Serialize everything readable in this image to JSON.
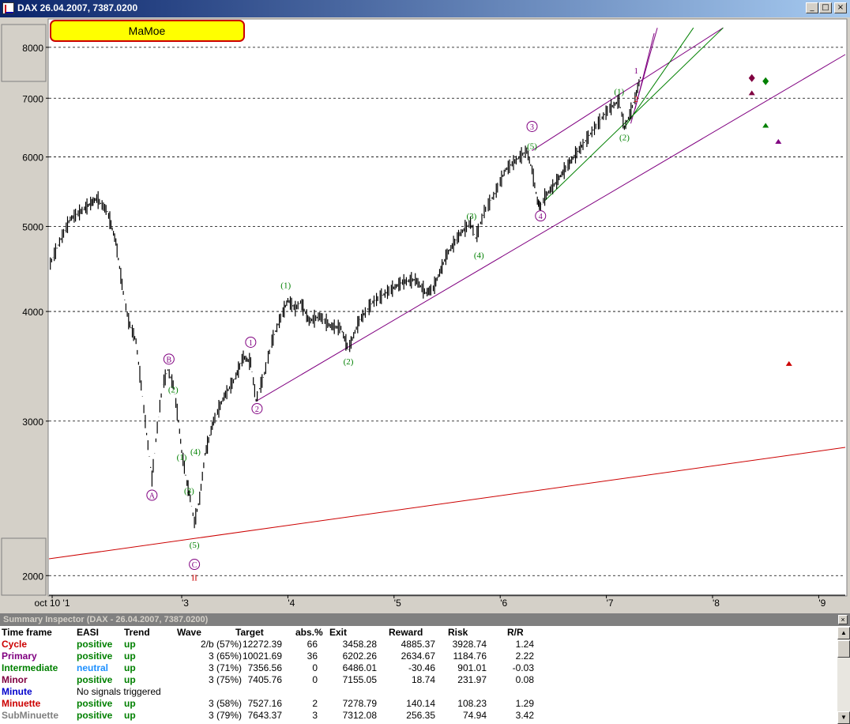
{
  "window": {
    "title": "DAX  26.04.2007, 7387.0200",
    "min_glyph": "_",
    "max_glyph": "□",
    "close_glyph": "×"
  },
  "chart_data": {
    "type": "line",
    "series_type": "ohlc-bars",
    "log_scale": true,
    "grid": "horizontal-dashed",
    "badge": "MaMoe",
    "y_ticks": [
      2000,
      3000,
      4000,
      5000,
      6000,
      7000,
      8000
    ],
    "x_ticks": [
      "oct 10 '1",
      "'3",
      "'4",
      "'5",
      "'6",
      "'7",
      "'8",
      "'9"
    ],
    "x_tick_years": [
      2001.78,
      2003.0,
      2004.0,
      2005.0,
      2006.0,
      2007.0,
      2008.0,
      2009.0
    ],
    "xlim": [
      2001.75,
      2009.25
    ],
    "ylim": [
      1900,
      8600
    ],
    "price_path": [
      [
        2001.75,
        4500
      ],
      [
        2001.85,
        4800
      ],
      [
        2001.95,
        5100
      ],
      [
        2002.05,
        5200
      ],
      [
        2002.2,
        5380
      ],
      [
        2002.3,
        5200
      ],
      [
        2002.38,
        4800
      ],
      [
        2002.45,
        4200
      ],
      [
        2002.5,
        3900
      ],
      [
        2002.57,
        3700
      ],
      [
        2002.63,
        3200
      ],
      [
        2002.67,
        2900
      ],
      [
        2002.72,
        2580
      ],
      [
        2002.77,
        2950
      ],
      [
        2002.82,
        3300
      ],
      [
        2002.87,
        3430
      ],
      [
        2002.92,
        3300
      ],
      [
        2002.97,
        3000
      ],
      [
        2003.0,
        2770
      ],
      [
        2003.05,
        2550
      ],
      [
        2003.08,
        2450
      ],
      [
        2003.12,
        2300
      ],
      [
        2003.17,
        2450
      ],
      [
        2003.22,
        2750
      ],
      [
        2003.3,
        3000
      ],
      [
        2003.4,
        3200
      ],
      [
        2003.5,
        3350
      ],
      [
        2003.58,
        3550
      ],
      [
        2003.65,
        3500
      ],
      [
        2003.7,
        3170
      ],
      [
        2003.78,
        3400
      ],
      [
        2003.85,
        3700
      ],
      [
        2003.92,
        3900
      ],
      [
        2004.0,
        4120
      ],
      [
        2004.07,
        4030
      ],
      [
        2004.12,
        4100
      ],
      [
        2004.2,
        3900
      ],
      [
        2004.3,
        3950
      ],
      [
        2004.4,
        3850
      ],
      [
        2004.5,
        3830
      ],
      [
        2004.57,
        3620
      ],
      [
        2004.67,
        3900
      ],
      [
        2004.8,
        4100
      ],
      [
        2004.95,
        4220
      ],
      [
        2005.08,
        4320
      ],
      [
        2005.2,
        4350
      ],
      [
        2005.3,
        4200
      ],
      [
        2005.37,
        4250
      ],
      [
        2005.5,
        4650
      ],
      [
        2005.62,
        4900
      ],
      [
        2005.72,
        5050
      ],
      [
        2005.77,
        4850
      ],
      [
        2005.85,
        5200
      ],
      [
        2005.95,
        5450
      ],
      [
        2006.05,
        5800
      ],
      [
        2006.15,
        5950
      ],
      [
        2006.25,
        6100
      ],
      [
        2006.3,
        5800
      ],
      [
        2006.35,
        5350
      ],
      [
        2006.38,
        5250
      ],
      [
        2006.42,
        5400
      ],
      [
        2006.52,
        5600
      ],
      [
        2006.65,
        5900
      ],
      [
        2006.78,
        6200
      ],
      [
        2006.9,
        6500
      ],
      [
        2007.02,
        6800
      ],
      [
        2007.12,
        6950
      ],
      [
        2007.17,
        6480
      ],
      [
        2007.22,
        6700
      ],
      [
        2007.27,
        7000
      ],
      [
        2007.32,
        7387
      ]
    ],
    "lines": [
      {
        "color": "#cc0000",
        "from": [
          2001.75,
          2090
        ],
        "to": [
          2009.25,
          2800
        ]
      },
      {
        "color": "#800080",
        "from": [
          2003.7,
          3160
        ],
        "to": [
          2009.25,
          7850
        ]
      },
      {
        "color": "#800080",
        "from": [
          2006.3,
          6100
        ],
        "to": [
          2008.1,
          8420
        ]
      },
      {
        "color": "#800080",
        "from": [
          2007.23,
          6550
        ],
        "to": [
          2007.48,
          8420
        ]
      },
      {
        "color": "#800080",
        "from": [
          2007.27,
          6800
        ],
        "to": [
          2007.45,
          8300
        ]
      },
      {
        "color": "#008000",
        "from": [
          2006.42,
          5350
        ],
        "to": [
          2008.1,
          8420
        ]
      },
      {
        "color": "#008000",
        "from": [
          2007.17,
          6480
        ],
        "to": [
          2007.82,
          8420
        ]
      }
    ],
    "wave_labels": [
      {
        "text": "A",
        "t": 2002.72,
        "v": 2470,
        "color": "#800080",
        "circle": true
      },
      {
        "text": "B",
        "t": 2002.88,
        "v": 3530,
        "color": "#800080",
        "circle": true
      },
      {
        "text": "C",
        "t": 2003.12,
        "v": 2060,
        "color": "#800080",
        "circle": true
      },
      {
        "text": "II",
        "t": 2003.12,
        "v": 1990,
        "color": "#cc0000",
        "circle": false
      },
      {
        "text": "(2)",
        "t": 2002.92,
        "v": 3260,
        "color": "#008000",
        "circle": false
      },
      {
        "text": "(1)",
        "t": 2003.0,
        "v": 2730,
        "color": "#008000",
        "circle": false
      },
      {
        "text": "(3)",
        "t": 2003.07,
        "v": 2500,
        "color": "#008000",
        "circle": false
      },
      {
        "text": "(4)",
        "t": 2003.13,
        "v": 2770,
        "color": "#008000",
        "circle": false
      },
      {
        "text": "(5)",
        "t": 2003.12,
        "v": 2170,
        "color": "#008000",
        "circle": false
      },
      {
        "text": "1",
        "t": 2003.65,
        "v": 3690,
        "color": "#800080",
        "circle": true
      },
      {
        "text": "2",
        "t": 2003.71,
        "v": 3100,
        "color": "#800080",
        "circle": true
      },
      {
        "text": "(1)",
        "t": 2003.98,
        "v": 4290,
        "color": "#008000",
        "circle": false
      },
      {
        "text": "(2)",
        "t": 2004.57,
        "v": 3510,
        "color": "#008000",
        "circle": false
      },
      {
        "text": "(3)",
        "t": 2005.73,
        "v": 5140,
        "color": "#008000",
        "circle": false
      },
      {
        "text": "(4)",
        "t": 2005.8,
        "v": 4640,
        "color": "#008000",
        "circle": false
      },
      {
        "text": "3",
        "t": 2006.3,
        "v": 6500,
        "color": "#800080",
        "circle": true
      },
      {
        "text": "(5)",
        "t": 2006.3,
        "v": 6180,
        "color": "#008000",
        "circle": false
      },
      {
        "text": "4",
        "t": 2006.38,
        "v": 5140,
        "color": "#800080",
        "circle": true
      },
      {
        "text": "(1)",
        "t": 2007.12,
        "v": 7130,
        "color": "#008000",
        "circle": false
      },
      {
        "text": "(2)",
        "t": 2007.17,
        "v": 6320,
        "color": "#008000",
        "circle": false
      },
      {
        "text": "1",
        "t": 2007.28,
        "v": 7530,
        "color": "#800080",
        "circle": false
      },
      {
        "text": "2",
        "t": 2007.28,
        "v": 6990,
        "color": "#cc0000",
        "circle": false
      }
    ],
    "targets": [
      {
        "shape": "diamond",
        "color": "#800040",
        "t": 2008.37,
        "v": 7380
      },
      {
        "shape": "diamond",
        "color": "#008000",
        "t": 2008.5,
        "v": 7320
      },
      {
        "shape": "triangle",
        "color": "#800040",
        "t": 2008.37,
        "v": 7100
      },
      {
        "shape": "triangle",
        "color": "#008000",
        "t": 2008.5,
        "v": 6520
      },
      {
        "shape": "triangle",
        "color": "#800080",
        "t": 2008.62,
        "v": 6250
      },
      {
        "shape": "triangle",
        "color": "#cc0000",
        "t": 2008.72,
        "v": 3490
      }
    ]
  },
  "inspector": {
    "title": "Summary Inspector (DAX - 26.04.2007, 7387.0200)",
    "close_glyph": "×",
    "columns": [
      "Time frame",
      "EASI",
      "Trend",
      "Wave",
      "Target",
      "abs.%",
      "Exit",
      "Reward",
      "Risk",
      "R/R"
    ],
    "rows": [
      {
        "tf": "Cycle",
        "tf_color": "#cc0000",
        "easi": "positive",
        "easi_color": "#008000",
        "trend": "up",
        "trend_color": "#008000",
        "wave": "2/b (57%)",
        "target": "12272.39",
        "abs": "66",
        "exit": "3458.28",
        "reward": "4885.37",
        "risk": "3928.74",
        "rr": "1.24"
      },
      {
        "tf": "Primary",
        "tf_color": "#800080",
        "easi": "positive",
        "easi_color": "#008000",
        "trend": "up",
        "trend_color": "#008000",
        "wave": "3 (65%)",
        "target": "10021.69",
        "abs": "36",
        "exit": "6202.26",
        "reward": "2634.67",
        "risk": "1184.76",
        "rr": "2.22"
      },
      {
        "tf": "Intermediate",
        "tf_color": "#008000",
        "easi": "neutral",
        "easi_color": "#1e90ff",
        "trend": "up",
        "trend_color": "#008000",
        "wave": "3 (71%)",
        "target": "7356.56",
        "abs": "0",
        "exit": "6486.01",
        "reward": "-30.46",
        "risk": "901.01",
        "rr": "-0.03"
      },
      {
        "tf": "Minor",
        "tf_color": "#800040",
        "easi": "positive",
        "easi_color": "#008000",
        "trend": "up",
        "trend_color": "#008000",
        "wave": "3 (75%)",
        "target": "7405.76",
        "abs": "0",
        "exit": "7155.05",
        "reward": "18.74",
        "risk": "231.97",
        "rr": "0.08"
      },
      {
        "tf": "Minute",
        "tf_color": "#0000cc",
        "easi": "No signals triggered",
        "easi_color": "#000000",
        "trend": "",
        "trend_color": "#008000",
        "wave": "",
        "target": "",
        "abs": "",
        "exit": "",
        "reward": "",
        "risk": "",
        "rr": ""
      },
      {
        "tf": "Minuette",
        "tf_color": "#cc0000",
        "easi": "positive",
        "easi_color": "#008000",
        "trend": "up",
        "trend_color": "#008000",
        "wave": "3 (58%)",
        "target": "7527.16",
        "abs": "2",
        "exit": "7278.79",
        "reward": "140.14",
        "risk": "108.23",
        "rr": "1.29"
      },
      {
        "tf": "SubMinuette",
        "tf_color": "#808080",
        "easi": "positive",
        "easi_color": "#008000",
        "trend": "up",
        "trend_color": "#008000",
        "wave": "3 (79%)",
        "target": "7643.37",
        "abs": "3",
        "exit": "7312.08",
        "reward": "256.35",
        "risk": "74.94",
        "rr": "3.42"
      }
    ]
  }
}
